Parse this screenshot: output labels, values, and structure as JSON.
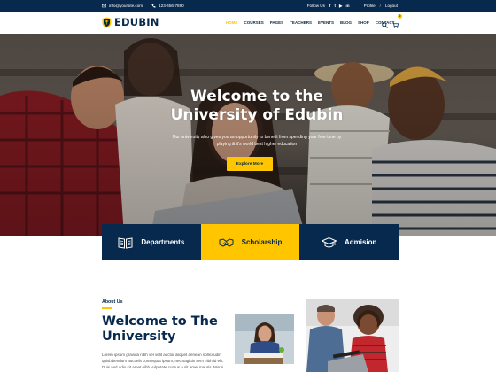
{
  "topbar": {
    "email": "info@yoursite.com",
    "phone": "123-456-7890",
    "follow_label": "Follow Us",
    "social": [
      "f",
      "t",
      "▶",
      "in"
    ],
    "profile_label": "Profile",
    "separator": "/",
    "logout_label": "Logout"
  },
  "header": {
    "logo_text": "EDUBIN",
    "nav": [
      "HOME",
      "COURSES",
      "PAGES",
      "TEACHERS",
      "EVENTS",
      "BLOG",
      "SHOP",
      "CONTACT"
    ],
    "cart_count": "0"
  },
  "hero": {
    "title_line1": "Welcome to the",
    "title_line2": "University of Edubin",
    "subtitle_line1": "Our university also gives you an opportunity to benefit from spending your free time by",
    "subtitle_line2": "playing & it's world best higher education",
    "button_label": "Explore More"
  },
  "features": [
    {
      "label": "Departments",
      "icon": "book-icon"
    },
    {
      "label": "Scholarship",
      "icon": "handshake-icon"
    },
    {
      "label": "Admision",
      "icon": "graduation-cap-icon"
    }
  ],
  "about": {
    "label": "About Us",
    "title_line1": "Welcome to The",
    "title_line2": "University",
    "text": "Lorem ipsum gravida nibh vel velit auctor aliquet aenean sollicitudin quisbibendum auct elit consequat ipsum, nec sagittis sem nibh id elit. Duis sed odio sit amet nibh vulputate cursus a sit amet mauris. Morbi"
  },
  "colors": {
    "navy": "#07294d",
    "accent": "#ffc600"
  }
}
